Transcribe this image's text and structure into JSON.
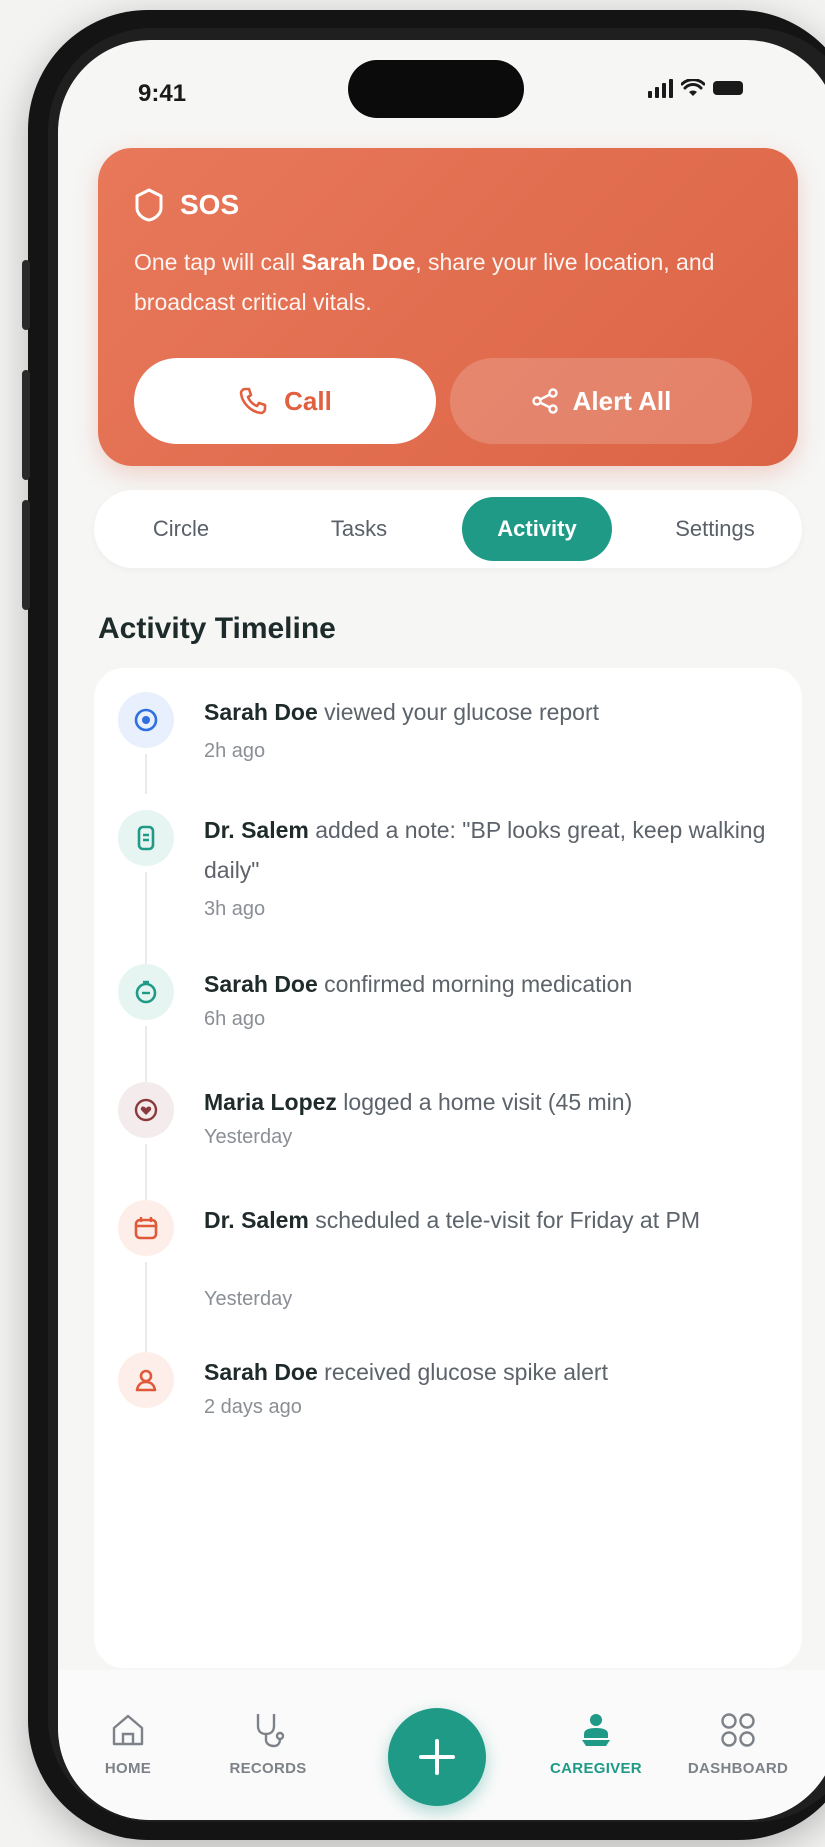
{
  "status_bar": {
    "time": "9:41"
  },
  "sos": {
    "title": "SOS",
    "desc_prefix": "One tap will call ",
    "desc_name": "Sarah Doe",
    "desc_suffix": ", share your live location, and broadcast critical vitals.",
    "call_label": "Call",
    "alert_label": "Alert All"
  },
  "tabs": [
    {
      "label": "Circle",
      "active": false
    },
    {
      "label": "Tasks",
      "active": false
    },
    {
      "label": "Activity",
      "active": true
    },
    {
      "label": "Settings",
      "active": false
    }
  ],
  "section_title": "Activity Timeline",
  "timeline": [
    {
      "actor": "Sarah Doe",
      "action": " viewed your glucose report",
      "time": "2h ago",
      "icon": "eye-icon",
      "color": "#2f6fde",
      "bg": "#e8f0fd"
    },
    {
      "actor": "Dr. Salem",
      "action": " added a note: \"BP looks great, keep walking daily\"",
      "time": "3h ago",
      "icon": "note-icon",
      "color": "#1e9a86",
      "bg": "#e6f5f2"
    },
    {
      "actor": "Sarah Doe",
      "action": " confirmed morning medication",
      "time": "6h ago",
      "icon": "pill-icon",
      "color": "#1e9a86",
      "bg": "#e6f5f2"
    },
    {
      "actor": "Maria Lopez",
      "action": " logged a home visit (45 min)",
      "time": "Yesterday",
      "icon": "heart-icon",
      "color": "#8a3a3a",
      "bg": "#f4ecec"
    },
    {
      "actor": "Dr. Salem",
      "action": " scheduled a tele-visit for Friday at PM",
      "time": "Yesterday",
      "icon": "calendar-icon",
      "color": "#e05a3a",
      "bg": "#fdeeea"
    },
    {
      "actor": "Sarah Doe",
      "action": " received glucose spike alert",
      "time": "2 days ago",
      "icon": "person-icon",
      "color": "#e05a3a",
      "bg": "#fdeeea"
    }
  ],
  "nav": [
    {
      "label": "HOME",
      "icon": "home-icon",
      "active": false
    },
    {
      "label": "RECORDS",
      "icon": "records-icon",
      "active": false
    },
    {
      "label": "CAREGIVER",
      "icon": "caregiver-icon",
      "active": true
    },
    {
      "label": "DASHBOARD",
      "icon": "dashboard-icon",
      "active": false
    }
  ],
  "colors": {
    "accent": "#1e9a86",
    "sos": "#e2603f"
  }
}
